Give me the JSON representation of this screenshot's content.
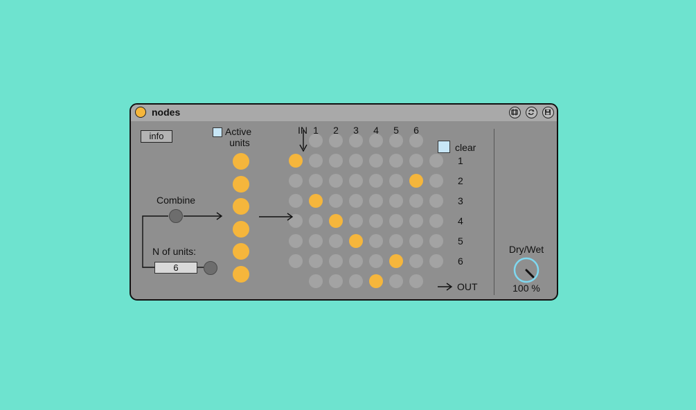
{
  "device": {
    "title": "nodes",
    "info_label": "info",
    "active_units_label": [
      "Active",
      "units"
    ],
    "combine_label": "Combine",
    "n_units_label": "N of units:",
    "n_units_value": "6",
    "clear_label": "clear",
    "in_label": "IN",
    "out_label": "OUT",
    "column_labels": [
      "1",
      "2",
      "3",
      "4",
      "5",
      "6"
    ],
    "row_labels": [
      "1",
      "2",
      "3",
      "4",
      "5",
      "6"
    ],
    "active_units": [
      true,
      true,
      true,
      true,
      true,
      true
    ],
    "matrix_active": [
      [
        1,
        0
      ],
      [
        2,
        6
      ],
      [
        3,
        1
      ],
      [
        4,
        2
      ],
      [
        5,
        3
      ],
      [
        6,
        5
      ],
      [
        7,
        4
      ]
    ],
    "drywet_label": "Dry/Wet",
    "drywet_value": "100 %",
    "drywet_level": 1.0,
    "colors": {
      "background": "#6ee3cf",
      "device": "#8f8f8f",
      "active": "#f5b63c",
      "inactive": "#a3a3a3",
      "knob_ring": "#7fd8f0"
    },
    "icons": [
      "power-icon",
      "freeze-icon",
      "hotswap-icon",
      "save-icon"
    ]
  }
}
